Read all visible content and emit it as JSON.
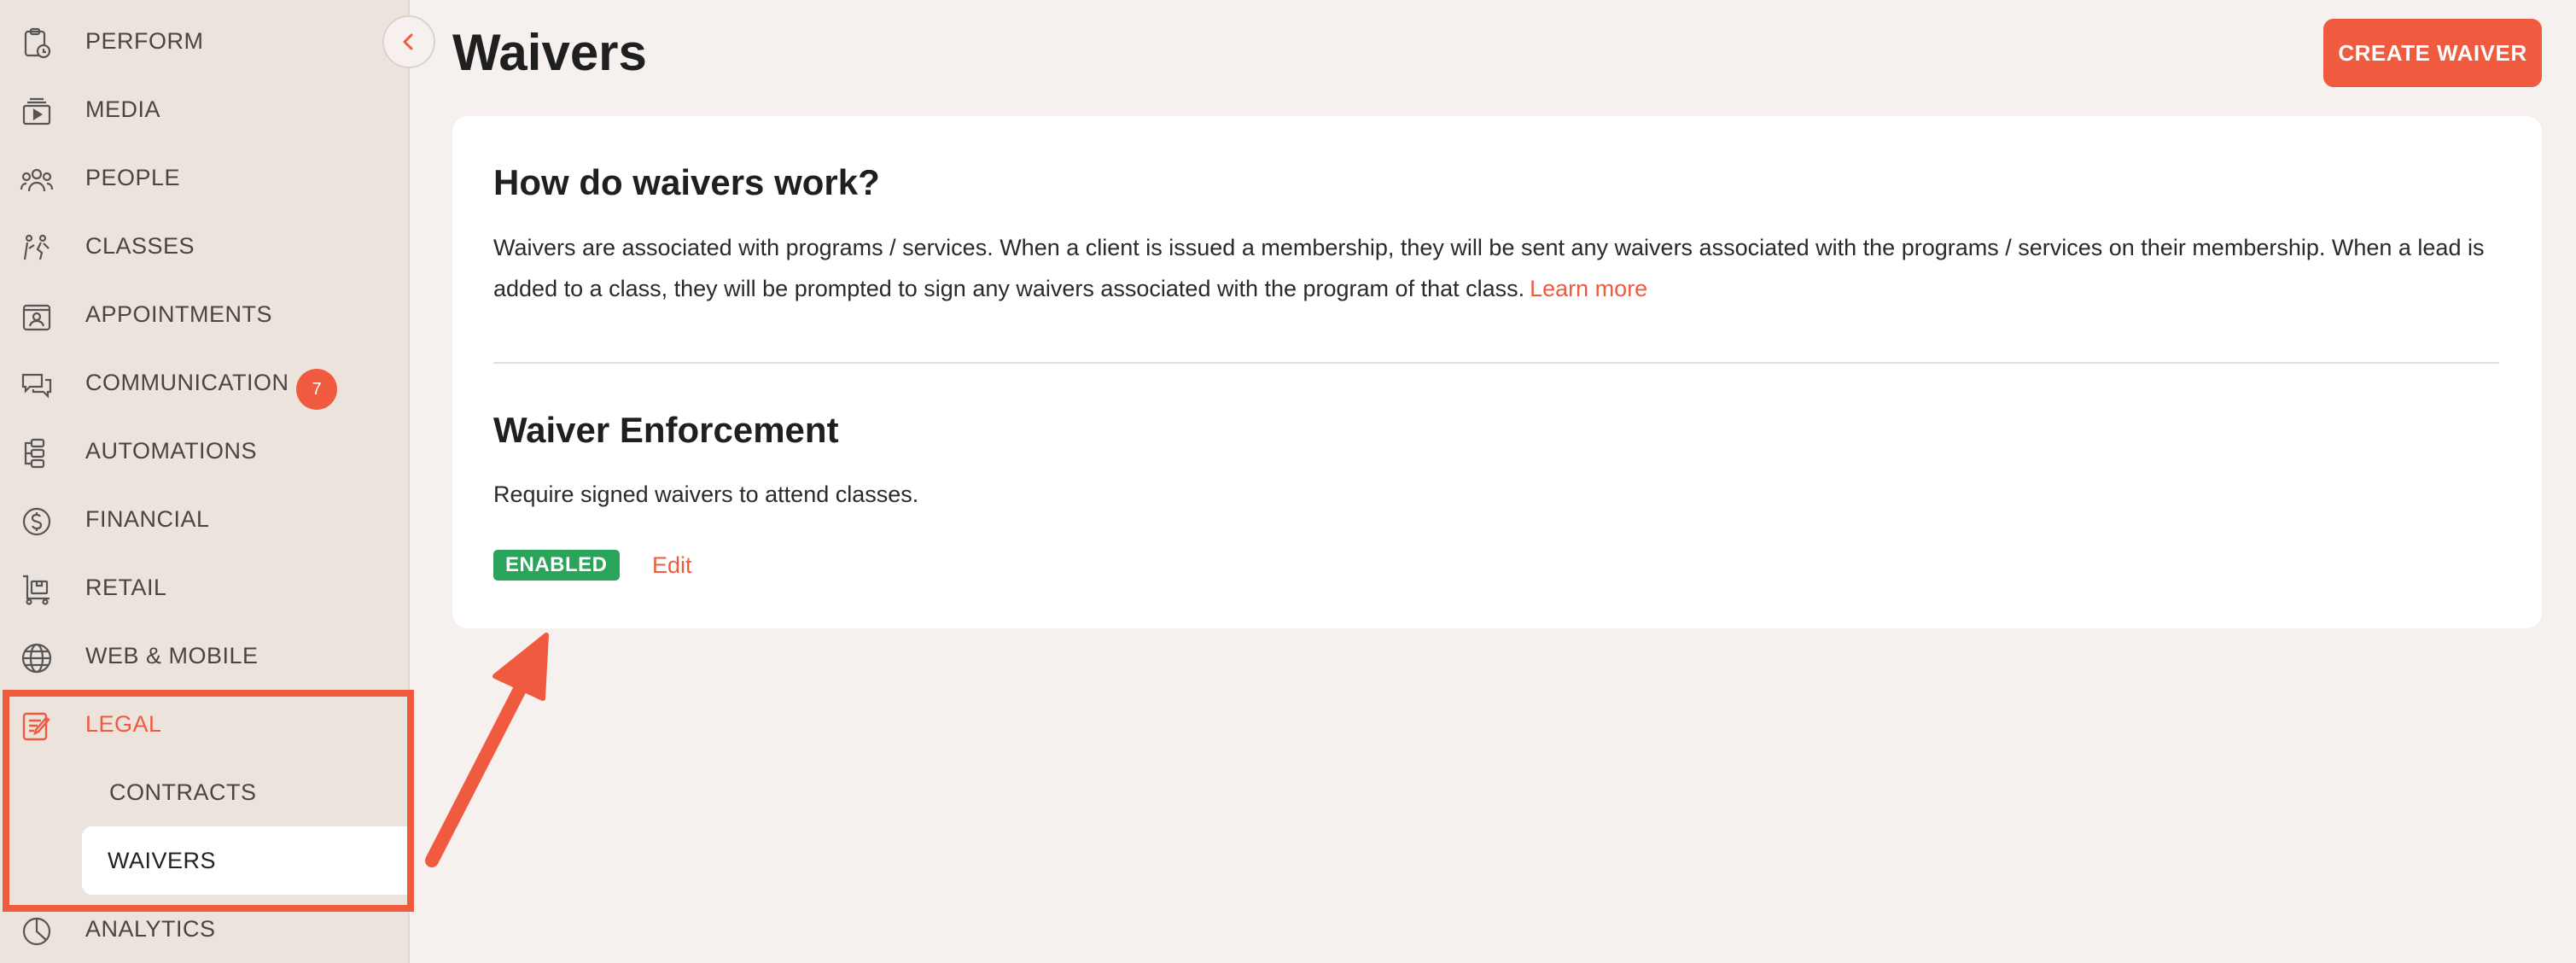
{
  "sidebar": {
    "items": [
      {
        "label": "PERFORM",
        "icon": "clipboard-clock-icon"
      },
      {
        "label": "MEDIA",
        "icon": "media-play-icon"
      },
      {
        "label": "PEOPLE",
        "icon": "people-icon"
      },
      {
        "label": "CLASSES",
        "icon": "classes-icon"
      },
      {
        "label": "APPOINTMENTS",
        "icon": "appointment-card-icon"
      },
      {
        "label": "COMMUNICATION",
        "icon": "chat-bubbles-icon",
        "badge": "7"
      },
      {
        "label": "AUTOMATIONS",
        "icon": "automation-flow-icon"
      },
      {
        "label": "FINANCIAL",
        "icon": "dollar-circle-icon"
      },
      {
        "label": "RETAIL",
        "icon": "retail-cart-icon"
      },
      {
        "label": "WEB & MOBILE",
        "icon": "globe-icon"
      },
      {
        "label": "LEGAL",
        "icon": "legal-document-icon",
        "active": true
      },
      {
        "label": "ANALYTICS",
        "icon": "pie-chart-icon"
      }
    ],
    "legal_subitems": [
      {
        "label": "CONTRACTS"
      },
      {
        "label": "WAIVERS",
        "selected": true
      }
    ]
  },
  "header": {
    "title": "Waivers",
    "create_button": "CREATE WAIVER"
  },
  "card": {
    "how_title": "How do waivers work?",
    "how_text": "Waivers are associated with programs / services. When a client is issued a membership, they will be sent any waivers associated with the programs / services on their membership. When a lead is added to a class, they will be prompted to sign any waivers associated with the program of that class.",
    "learn_more": "Learn more",
    "enforcement_title": "Waiver Enforcement",
    "enforcement_text": "Require signed waivers to attend classes.",
    "status": "ENABLED",
    "edit": "Edit"
  },
  "colors": {
    "accent": "#f05a3f",
    "enabled": "#2aa35b",
    "sidebar_bg": "#ede3dd",
    "page_bg": "#f6f1ee"
  }
}
